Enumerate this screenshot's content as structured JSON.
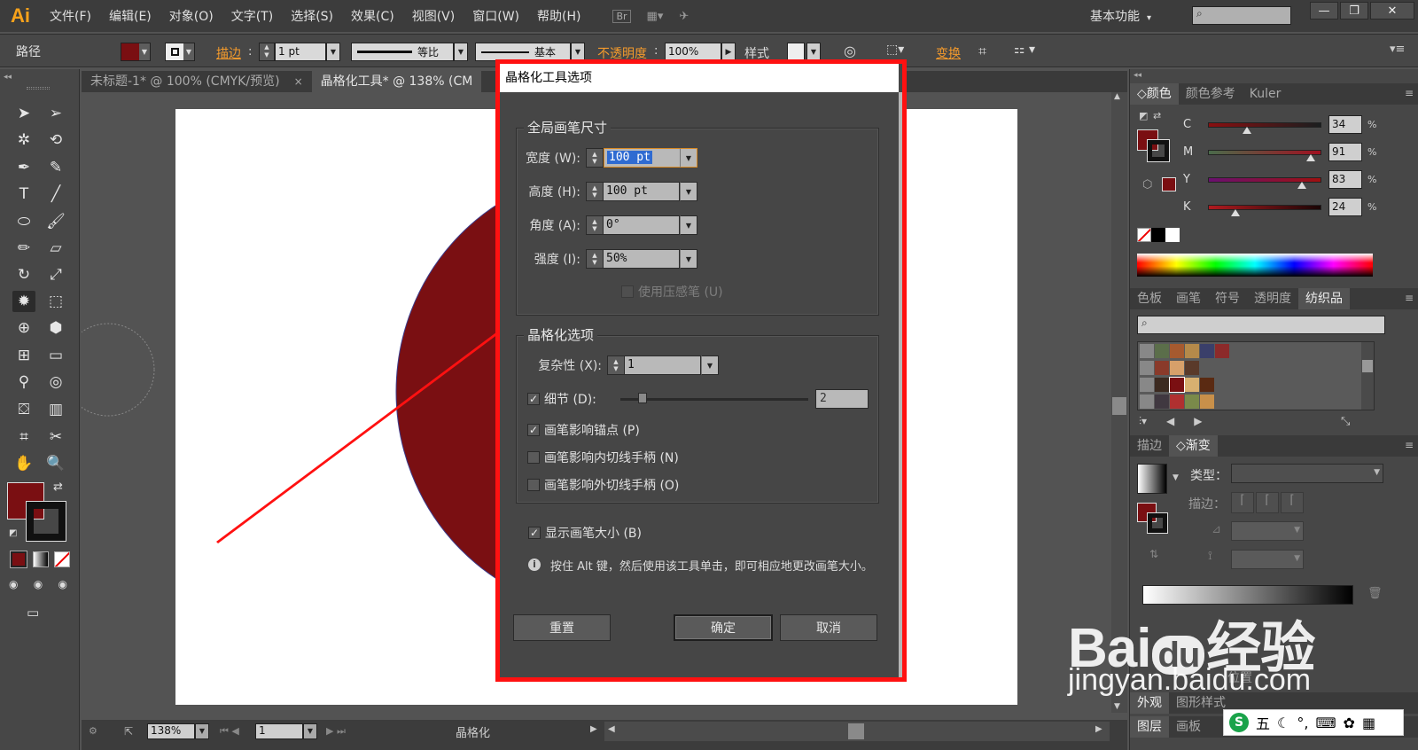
{
  "app": {
    "logo": "Ai",
    "menus": [
      "文件(F)",
      "编辑(E)",
      "对象(O)",
      "文字(T)",
      "选择(S)",
      "效果(C)",
      "视图(V)",
      "窗口(W)",
      "帮助(H)"
    ],
    "bridge_badge": "Br",
    "workspace": "基本功能",
    "search_placeholder": ""
  },
  "control_bar": {
    "selection_label": "路径",
    "fill_color": "#7a0f12",
    "stroke_label": "描边",
    "stroke_weight": "1 pt",
    "profile_label": "等比",
    "brush_label": "基本",
    "opacity_label": "不透明度",
    "opacity_value": "100%",
    "style_label": "样式",
    "transform_label": "变换"
  },
  "tabs": [
    {
      "label": "未标题-1* @ 100% (CMYK/预览)",
      "close": "×"
    },
    {
      "label": "晶格化工具* @ 138% (CM",
      "close": ""
    }
  ],
  "status_bar": {
    "zoom": "138%",
    "page": "1",
    "tool_name": "晶格化"
  },
  "dialog": {
    "title": "晶格化工具选项",
    "group1_title": "全局画笔尺寸",
    "width_label": "宽度 (W):",
    "width_value_highlight": "100 pt",
    "height_label": "高度 (H):",
    "height_value": "100 pt",
    "angle_label": "角度 (A):",
    "angle_value": "0°",
    "intensity_label": "强度 (I):",
    "intensity_value": "50%",
    "pressure_label": "使用压感笔 (U)",
    "group2_title": "晶格化选项",
    "complexity_label": "复杂性 (X):",
    "complexity_value": "1",
    "detail_label": "细节 (D):",
    "detail_value": "2",
    "detail_fraction": 0.1,
    "anchor_label": "画笔影响锚点 (P)",
    "in_tangent_label": "画笔影响内切线手柄 (N)",
    "out_tangent_label": "画笔影响外切线手柄 (O)",
    "show_size_label": "显示画笔大小 (B)",
    "info_text": "按住 Alt 键，然后使用该工具单击，即可相应地更改画笔大小。",
    "reset_label": "重置",
    "ok_label": "确定",
    "cancel_label": "取消"
  },
  "color_panel": {
    "tabs": [
      "颜色",
      "颜色参考",
      "Kuler"
    ],
    "channels": [
      {
        "name": "C",
        "value": "34",
        "fraction": 0.34
      },
      {
        "name": "M",
        "value": "91",
        "fraction": 0.91
      },
      {
        "name": "Y",
        "value": "83",
        "fraction": 0.83
      },
      {
        "name": "K",
        "value": "24",
        "fraction": 0.24
      }
    ],
    "pct": "%"
  },
  "swatches_panel": {
    "tabs": [
      "色板",
      "画笔",
      "符号",
      "透明度",
      "纺织品"
    ]
  },
  "gradient_panel": {
    "tabs": [
      "描边",
      "渐变"
    ],
    "type_label": "类型：",
    "stroke_label": "描边：",
    "position_label": "位置"
  },
  "bottom_panels": {
    "appearance_tabs": [
      "外观",
      "图形样式"
    ],
    "layers_tabs": [
      "图层",
      "画板"
    ]
  },
  "colors": {
    "accent_red": "#ff1111",
    "shape_fill": "#7a0f12"
  },
  "watermark": {
    "logo": "Bai du 经验",
    "url": "jingyan.baidu.com"
  },
  "ime": {
    "text": "五"
  }
}
